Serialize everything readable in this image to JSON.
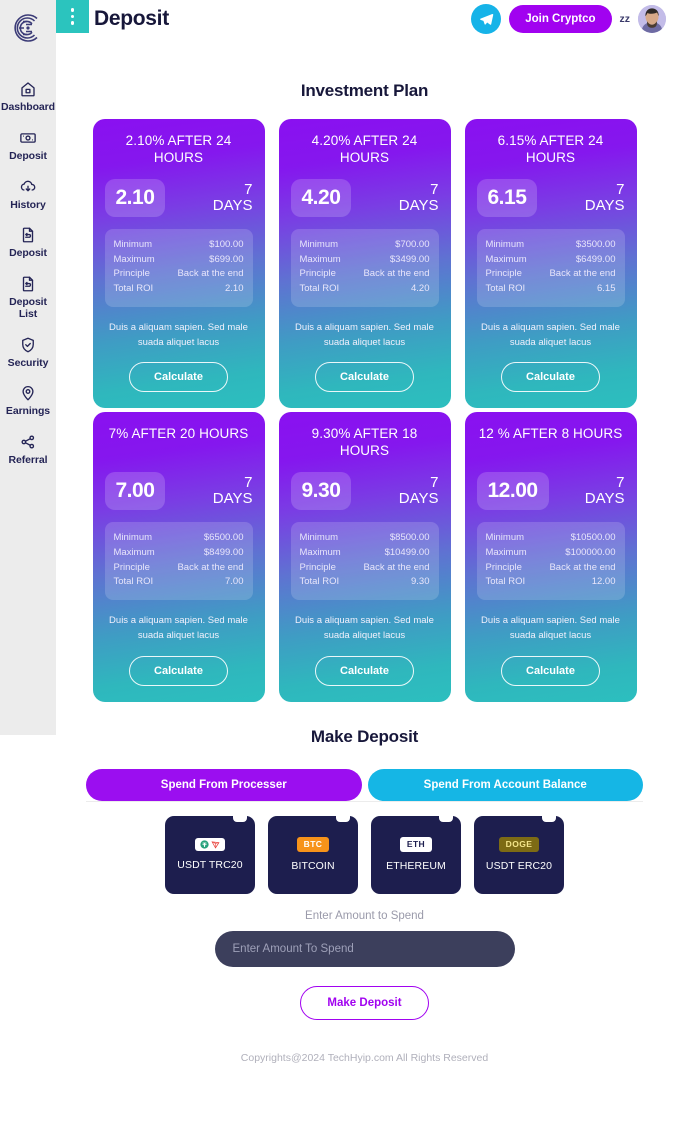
{
  "brand": {
    "logo_icon": "crypto-c-logo",
    "accent_purple": "#a102f0",
    "accent_teal": "#2bc4be",
    "accent_blue": "#15b6e5"
  },
  "header": {
    "title": "Deposit",
    "menu_icon": "kebab-menu-icon",
    "telegram_icon": "telegram-icon",
    "join_label": "Join Cryptco",
    "user_initials": "zz",
    "avatar_icon": "user-avatar"
  },
  "sidebar": {
    "items": [
      {
        "label": "Dashboard",
        "icon": "home-icon"
      },
      {
        "label": "Deposit",
        "icon": "money-icon"
      },
      {
        "label": "History",
        "icon": "cloud-download-icon"
      },
      {
        "label": "Deposit",
        "icon": "file-return-icon"
      },
      {
        "label": "Deposit List",
        "icon": "file-return-icon"
      },
      {
        "label": "Security",
        "icon": "shield-check-icon"
      },
      {
        "label": "Earnings",
        "icon": "location-pin-icon"
      },
      {
        "label": "Referral",
        "icon": "share-nodes-icon"
      }
    ]
  },
  "investment": {
    "title": "Investment Plan",
    "spec_labels": {
      "minimum": "Minimum",
      "maximum": "Maximum",
      "principle": "Principle",
      "total_roi": "Total ROI"
    },
    "note": "Duis a aliquam sapien. Sed male\nsuada aliquet lacus",
    "note_line1": "Duis a aliquam sapien. Sed male",
    "note_line2": "suada aliquet lacus",
    "calculate_label": "Calculate",
    "plans": [
      {
        "heading": "2.10% AFTER 24 HOURS",
        "rate": "2.10",
        "days_number": "7",
        "days_unit": "DAYS",
        "minimum": "$100.00",
        "maximum": "$699.00",
        "principle": "Back at the end",
        "total_roi": "2.10"
      },
      {
        "heading": "4.20% AFTER 24 HOURS",
        "rate": "4.20",
        "days_number": "7",
        "days_unit": "DAYS",
        "minimum": "$700.00",
        "maximum": "$3499.00",
        "principle": "Back at the end",
        "total_roi": "4.20"
      },
      {
        "heading": "6.15% AFTER 24 HOURS",
        "rate": "6.15",
        "days_number": "7",
        "days_unit": "DAYS",
        "minimum": "$3500.00",
        "maximum": "$6499.00",
        "principle": "Back at the end",
        "total_roi": "6.15"
      },
      {
        "heading": "7% AFTER 20 HOURS",
        "rate": "7.00",
        "days_number": "7",
        "days_unit": "DAYS",
        "minimum": "$6500.00",
        "maximum": "$8499.00",
        "principle": "Back at the end",
        "total_roi": "7.00"
      },
      {
        "heading": "9.30% AFTER 18 HOURS",
        "rate": "9.30",
        "days_number": "7",
        "days_unit": "DAYS",
        "minimum": "$8500.00",
        "maximum": "$10499.00",
        "principle": "Back at the end",
        "total_roi": "9.30"
      },
      {
        "heading": "12 % AFTER 8 HOURS",
        "rate": "12.00",
        "days_number": "7",
        "days_unit": "DAYS",
        "minimum": "$10500.00",
        "maximum": "$100000.00",
        "principle": "Back at the end",
        "total_roi": "12.00"
      }
    ]
  },
  "deposit": {
    "title": "Make Deposit",
    "tabs": [
      {
        "label": "Spend From Processer",
        "active": true,
        "color": "#9b0ef0"
      },
      {
        "label": "Spend From Account Balance",
        "active": false,
        "color": "#15b6e5"
      }
    ],
    "methods": [
      {
        "label": "USDT TRC20",
        "badge": "",
        "icon": "usdt-tron-icon"
      },
      {
        "label": "BITCOIN",
        "badge": "BTC",
        "icon": "bitcoin-icon"
      },
      {
        "label": "ETHEREUM",
        "badge": "ETH",
        "icon": "ethereum-icon"
      },
      {
        "label": "USDT ERC20",
        "badge": "DOGE",
        "icon": "dogecoin-icon"
      }
    ],
    "amount_label": "Enter Amount to Spend",
    "amount_placeholder": "Enter Amount To Spend",
    "amount_value": "",
    "submit_label": "Make Deposit"
  },
  "footer": {
    "text": "Copyrights@2024 TechHyip.com All Rights Reserved"
  }
}
